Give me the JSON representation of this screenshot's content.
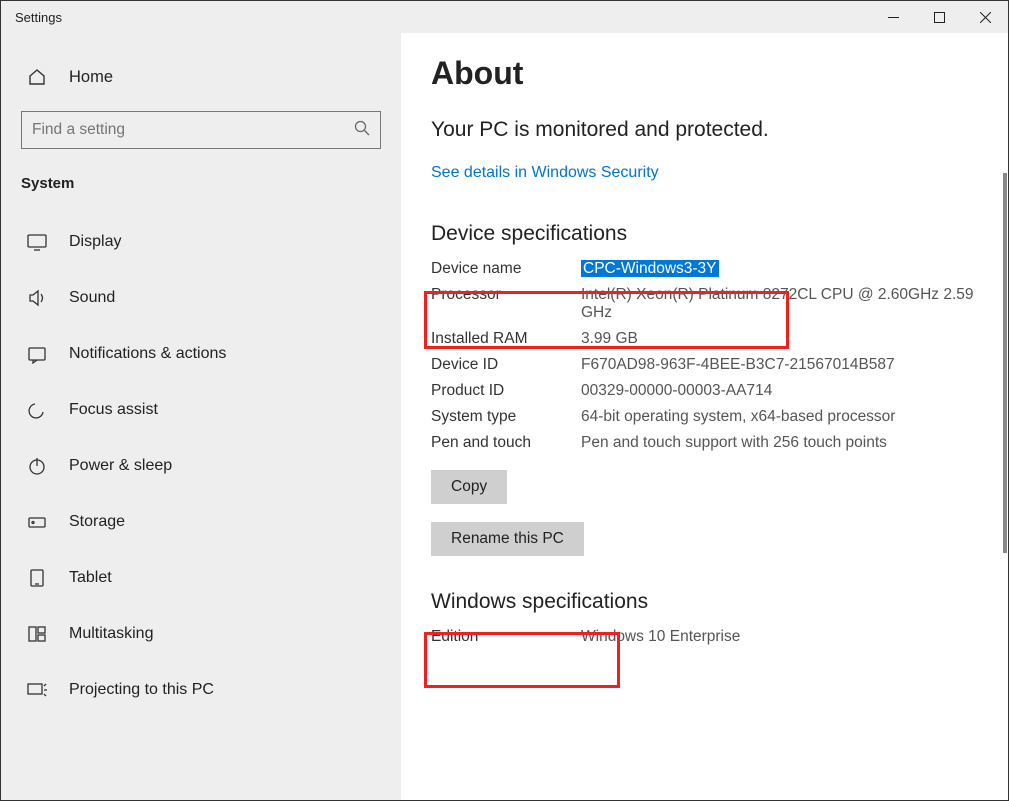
{
  "window": {
    "title": "Settings"
  },
  "sidebar": {
    "home_label": "Home",
    "search_placeholder": "Find a setting",
    "category": "System",
    "items": [
      {
        "label": "Display"
      },
      {
        "label": "Sound"
      },
      {
        "label": "Notifications & actions"
      },
      {
        "label": "Focus assist"
      },
      {
        "label": "Power & sleep"
      },
      {
        "label": "Storage"
      },
      {
        "label": "Tablet"
      },
      {
        "label": "Multitasking"
      },
      {
        "label": "Projecting to this PC"
      }
    ]
  },
  "main": {
    "title": "About",
    "protect_line": "Your PC is monitored and protected.",
    "security_link": "See details in Windows Security",
    "device_spec_heading": "Device specifications",
    "specs": {
      "device_name_label": "Device name",
      "device_name_value": "CPC-Windows3-3Y",
      "processor_label": "Processor",
      "processor_value": "Intel(R) Xeon(R) Platinum 8272CL CPU @ 2.60GHz 2.59 GHz",
      "ram_label": "Installed RAM",
      "ram_value": "3.99 GB",
      "deviceid_label": "Device ID",
      "deviceid_value": "F670AD98-963F-4BEE-B3C7-21567014B587",
      "productid_label": "Product ID",
      "productid_value": "00329-00000-00003-AA714",
      "systype_label": "System type",
      "systype_value": "64-bit operating system, x64-based processor",
      "pen_label": "Pen and touch",
      "pen_value": "Pen and touch support with 256 touch points"
    },
    "copy_btn": "Copy",
    "rename_btn": "Rename this PC",
    "winspec_heading": "Windows specifications",
    "winspec": {
      "edition_label": "Edition",
      "edition_value": "Windows 10 Enterprise"
    }
  }
}
